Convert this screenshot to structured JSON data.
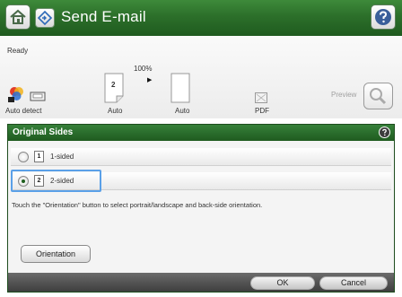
{
  "header": {
    "title": "Send E-mail",
    "accent_color": "#2c6f2a",
    "home_icon": "home-icon",
    "app_icon": "email-app-icon",
    "help_icon": "help-icon"
  },
  "status": {
    "text": "Ready"
  },
  "settings": {
    "zoom_value": "100%",
    "items": [
      {
        "label": "Auto detect",
        "icon": "color-mode-icon"
      },
      {
        "label": "Auto",
        "icon": "page-sides-icon",
        "badge": "2"
      },
      {
        "label": "Auto",
        "icon": "document-size-icon"
      },
      {
        "label": "PDF",
        "icon": "pdf-file-icon"
      }
    ],
    "preview_label": "Preview"
  },
  "dialog": {
    "title": "Original Sides",
    "options": [
      {
        "label": "1-sided",
        "badge": "1",
        "selected": false
      },
      {
        "label": "2-sided",
        "badge": "2",
        "selected": true
      }
    ],
    "instructions": "Touch the \"Orientation\" button to select portrait/landscape and back-side orientation.",
    "orientation_button": "Orientation",
    "ok_button": "OK",
    "cancel_button": "Cancel"
  }
}
